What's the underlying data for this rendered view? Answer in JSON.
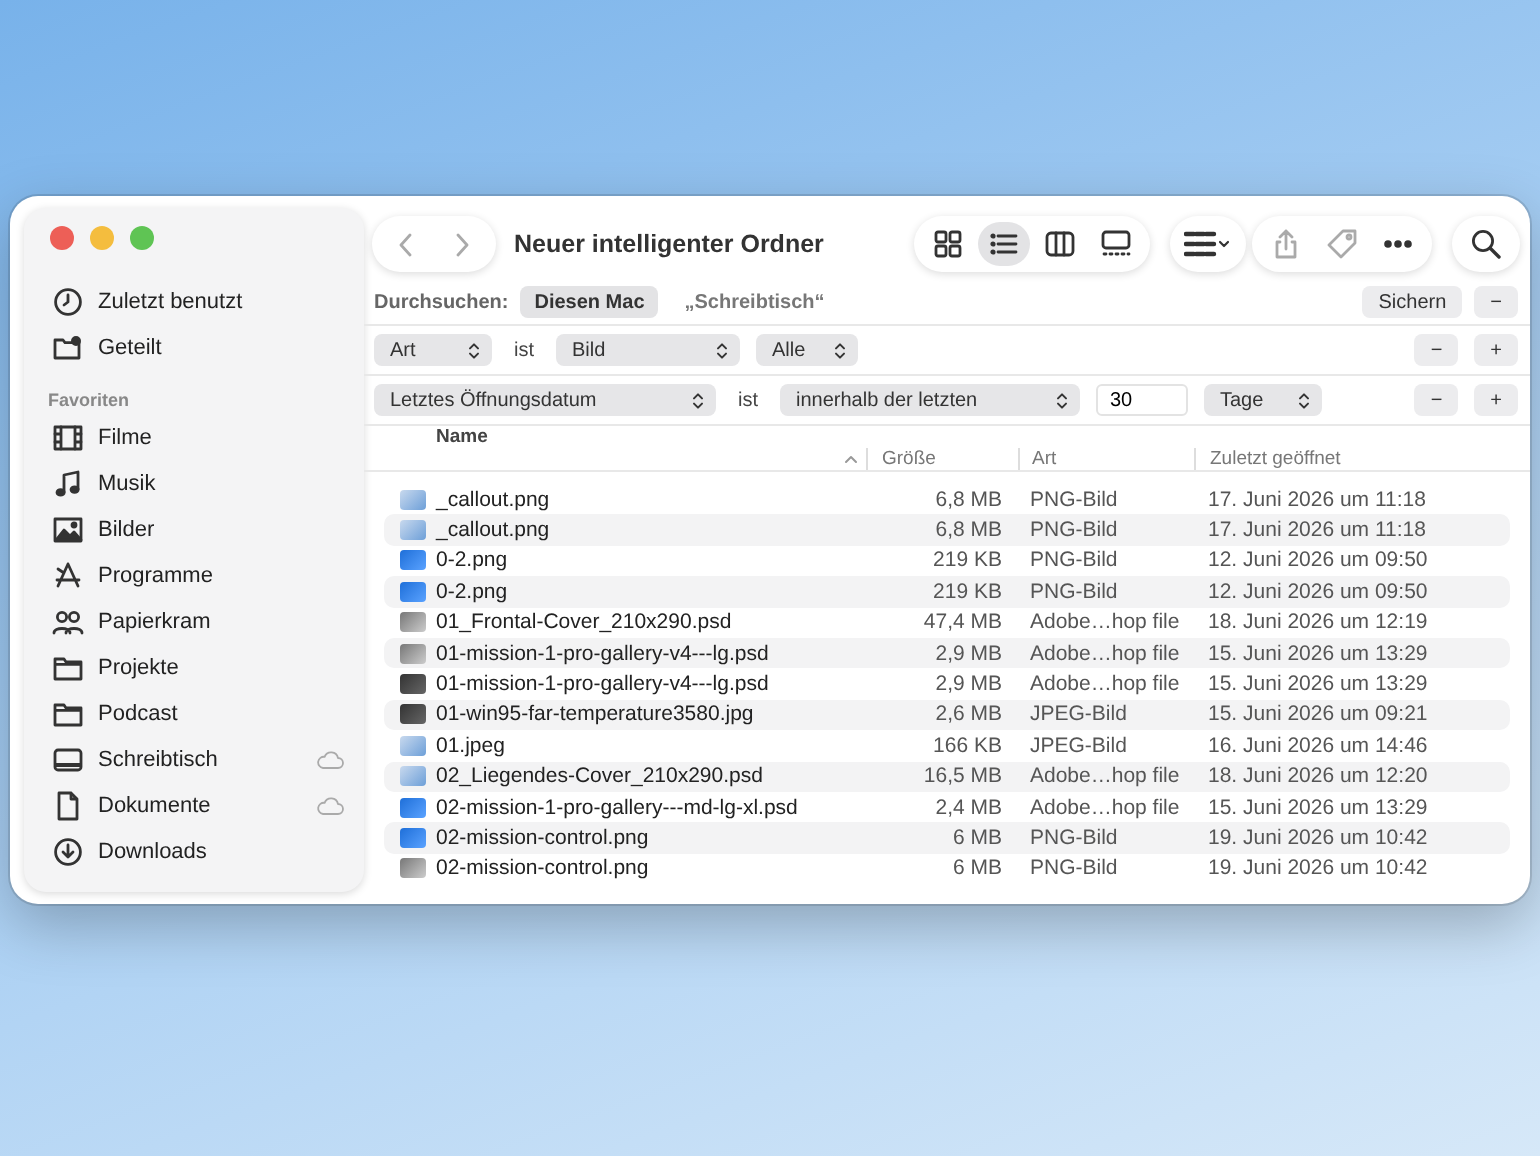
{
  "window": {
    "title": "Neuer intelligenter Ordner"
  },
  "toolbar": {
    "views": [
      {
        "selected": false
      },
      {
        "selected": true
      },
      {
        "selected": false
      },
      {
        "selected": false
      }
    ]
  },
  "sidebar": {
    "items": [
      {
        "label": "Zuletzt benutzt"
      },
      {
        "label": "Geteilt"
      }
    ],
    "sections": [
      {
        "title": "Favoriten",
        "items": [
          {
            "label": "Filme",
            "cloud": false
          },
          {
            "label": "Musik",
            "cloud": false
          },
          {
            "label": "Bilder",
            "cloud": false
          },
          {
            "label": "Programme",
            "cloud": false
          },
          {
            "label": "Papierkram",
            "cloud": false
          },
          {
            "label": "Projekte",
            "cloud": false
          },
          {
            "label": "Podcast",
            "cloud": false
          },
          {
            "label": "Schreibtisch",
            "cloud": true
          },
          {
            "label": "Dokumente",
            "cloud": true
          },
          {
            "label": "Downloads",
            "cloud": false
          }
        ]
      }
    ]
  },
  "search_scope": {
    "label": "Durchsuchen:",
    "scopes": [
      {
        "label": "Diesen Mac",
        "selected": true
      },
      {
        "label": "„Schreibtisch“",
        "selected": false
      }
    ],
    "save": "Sichern",
    "remove": "−"
  },
  "criteria": [
    {
      "fields": [
        {
          "kind": "popup",
          "value": "Art"
        },
        {
          "kind": "text",
          "value": "ist"
        },
        {
          "kind": "popup",
          "value": "Bild"
        },
        {
          "kind": "popup",
          "value": "Alle"
        }
      ],
      "buttons": [
        "−",
        "+"
      ]
    },
    {
      "fields": [
        {
          "kind": "popup",
          "value": "Letztes Öffnungsdatum"
        },
        {
          "kind": "text",
          "value": "ist"
        },
        {
          "kind": "popup",
          "value": "innerhalb der letzten"
        },
        {
          "kind": "input",
          "value": "30"
        },
        {
          "kind": "popup",
          "value": "Tage"
        }
      ],
      "buttons": [
        "−",
        "+"
      ]
    }
  ],
  "table": {
    "columns": [
      "Name",
      "Größe",
      "Art",
      "Zuletzt geöffnet"
    ],
    "rows": [
      {
        "name": "_callout.png",
        "size": "6,8 MB",
        "kind": "PNG-Bild",
        "opened": "17. Juni 2026 um 11:18"
      },
      {
        "name": "_callout.png",
        "size": "6,8 MB",
        "kind": "PNG-Bild",
        "opened": "17. Juni 2026 um 11:18"
      },
      {
        "name": "0-2.png",
        "size": "219 KB",
        "kind": "PNG-Bild",
        "opened": "12. Juni 2026 um 09:50"
      },
      {
        "name": "0-2.png",
        "size": "219 KB",
        "kind": "PNG-Bild",
        "opened": "12. Juni 2026 um 09:50"
      },
      {
        "name": "01_Frontal-Cover_210x290.psd",
        "size": "47,4 MB",
        "kind": "Adobe…hop file",
        "opened": "18. Juni 2026 um 12:19"
      },
      {
        "name": "01-mission-1-pro-gallery-v4---lg.psd",
        "size": "2,9 MB",
        "kind": "Adobe…hop file",
        "opened": "15. Juni 2026 um 13:29"
      },
      {
        "name": "01-mission-1-pro-gallery-v4---lg.psd",
        "size": "2,9 MB",
        "kind": "Adobe…hop file",
        "opened": "15. Juni 2026 um 13:29"
      },
      {
        "name": "01-win95-far-temperature3580.jpg",
        "size": "2,6 MB",
        "kind": "JPEG-Bild",
        "opened": "15. Juni 2026 um 09:21"
      },
      {
        "name": "01.jpeg",
        "size": "166 KB",
        "kind": "JPEG-Bild",
        "opened": "16. Juni 2026 um 14:46"
      },
      {
        "name": "02_Liegendes-Cover_210x290.psd",
        "size": "16,5 MB",
        "kind": "Adobe…hop file",
        "opened": "18. Juni 2026 um 12:20"
      },
      {
        "name": "02-mission-1-pro-gallery---md-lg-xl.psd",
        "size": "2,4 MB",
        "kind": "Adobe…hop file",
        "opened": "15. Juni 2026 um 13:29"
      },
      {
        "name": "02-mission-control.png",
        "size": "6 MB",
        "kind": "PNG-Bild",
        "opened": "19. Juni 2026 um 10:42"
      },
      {
        "name": "02-mission-control.png",
        "size": "6 MB",
        "kind": "PNG-Bild",
        "opened": "19. Juni 2026 um 10:42"
      }
    ]
  }
}
